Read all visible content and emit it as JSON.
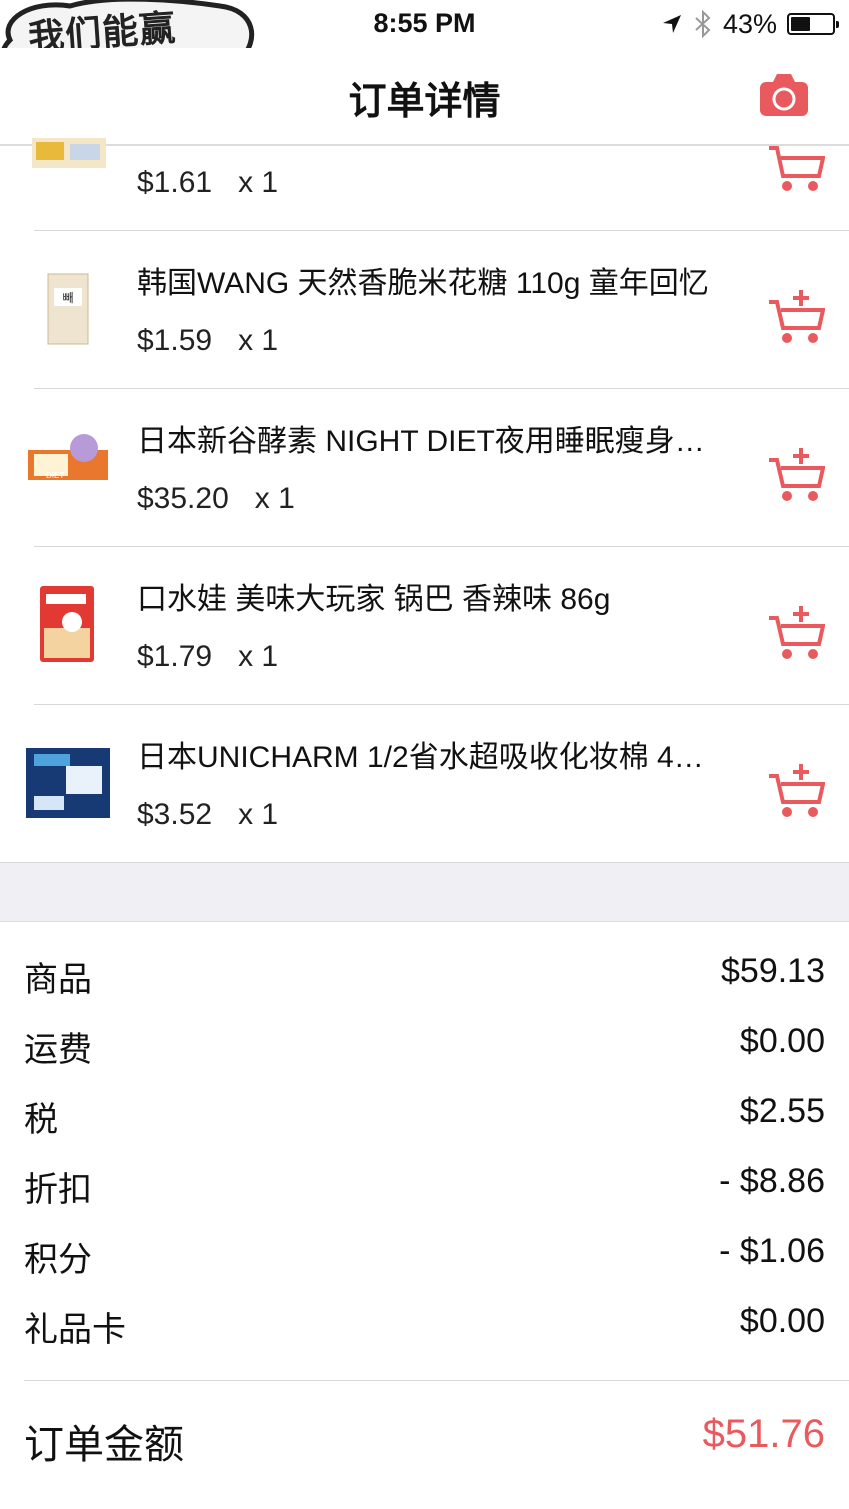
{
  "status_bar": {
    "time": "8:55 PM",
    "battery_percent": "43%",
    "battery_level": 0.43
  },
  "logo": {
    "text": "我们能赢"
  },
  "nav": {
    "title": "订单详情",
    "camera_icon": "camera-icon"
  },
  "accent_color": "#e85a5e",
  "items": [
    {
      "name": "",
      "price": "$1.61",
      "qty": "x 1"
    },
    {
      "name": "韩国WANG 天然香脆米花糖 110g 童年回忆",
      "price": "$1.59",
      "qty": "x 1"
    },
    {
      "name": "日本新谷酵素 NIGHT DIET夜用睡眠瘦身…",
      "price": "$35.20",
      "qty": "x 1"
    },
    {
      "name": "口水娃 美味大玩家 锅巴 香辣味 86g",
      "price": "$1.79",
      "qty": "x 1"
    },
    {
      "name": "日本UNICHARM 1/2省水超吸收化妆棉 4…",
      "price": "$3.52",
      "qty": "x 1"
    }
  ],
  "summary": [
    {
      "label": "商品",
      "value": "$59.13"
    },
    {
      "label": "运费",
      "value": "$0.00"
    },
    {
      "label": "税",
      "value": "$2.55"
    },
    {
      "label": "折扣",
      "value": "- $8.86"
    },
    {
      "label": "积分",
      "value": "- $1.06"
    },
    {
      "label": "礼品卡",
      "value": "$0.00"
    }
  ],
  "total": {
    "label": "订单金额",
    "value": "$51.76"
  }
}
